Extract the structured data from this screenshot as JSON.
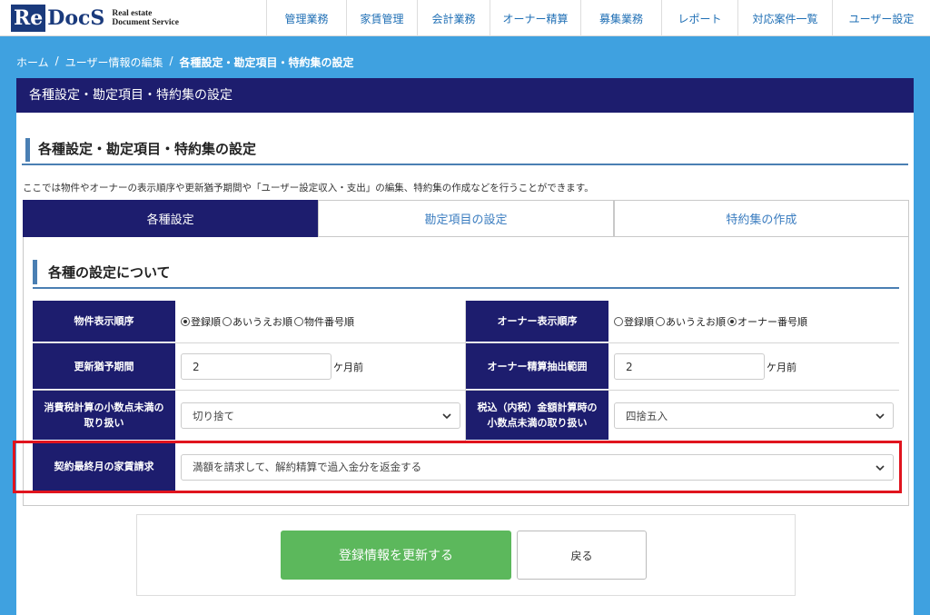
{
  "logo": {
    "re": "Re",
    "docs": "DocS",
    "line1": "Real estate",
    "line2": "Document Service"
  },
  "nav": [
    "管理業務",
    "家賃管理",
    "会計業務",
    "オーナー精算",
    "募集業務",
    "レポート",
    "対応案件一覧",
    "ユーザー設定"
  ],
  "breadcrumb": {
    "home": "ホーム",
    "sep": "/",
    "parent": "ユーザー情報の編集",
    "current": "各種設定・勘定項目・特約集の設定"
  },
  "panel": {
    "header": "各種設定・勘定項目・特約集の設定"
  },
  "section": {
    "title": "各種設定・勘定項目・特約集の設定",
    "description": "ここでは物件やオーナーの表示順序や更新猶予期間や「ユーザー設定収入・支出」の編集、特約集の作成などを行うことができます。"
  },
  "tabs": [
    "各種設定",
    "勘定項目の設定",
    "特約集の作成"
  ],
  "settings": {
    "subtitle": "各種の設定について",
    "property_order": {
      "label": "物件表示順序",
      "options": [
        "登録順",
        "あいうえお順",
        "物件番号順"
      ],
      "selected": 0
    },
    "owner_order": {
      "label": "オーナー表示順序",
      "options": [
        "登録順",
        "あいうえお順",
        "オーナー番号順"
      ],
      "selected": 2
    },
    "renewal_grace": {
      "label": "更新猶予期間",
      "value": "2",
      "unit": "ケ月前"
    },
    "owner_extract": {
      "label": "オーナー精算抽出範囲",
      "value": "2",
      "unit": "ケ月前"
    },
    "tax_decimal": {
      "label_line1": "消費税計算の小数点未満の",
      "label_line2": "取り扱い",
      "value": "切り捨て"
    },
    "inclusive_decimal": {
      "label_line1": "税込（内税）金額計算時の",
      "label_line2": "小数点未満の取り扱い",
      "value": "四捨五入"
    },
    "final_month": {
      "label": "契約最終月の家賃請求",
      "value": "満額を請求して、解約精算で過入金分を返金する"
    }
  },
  "buttons": {
    "update": "登録情報を更新する",
    "back": "戻る"
  },
  "colors": {
    "navy": "#1d1d6e",
    "accent": "#4a7fb3",
    "green": "#5cb85c",
    "highlight": "#e0141e",
    "bg": "#3fa1e0"
  }
}
